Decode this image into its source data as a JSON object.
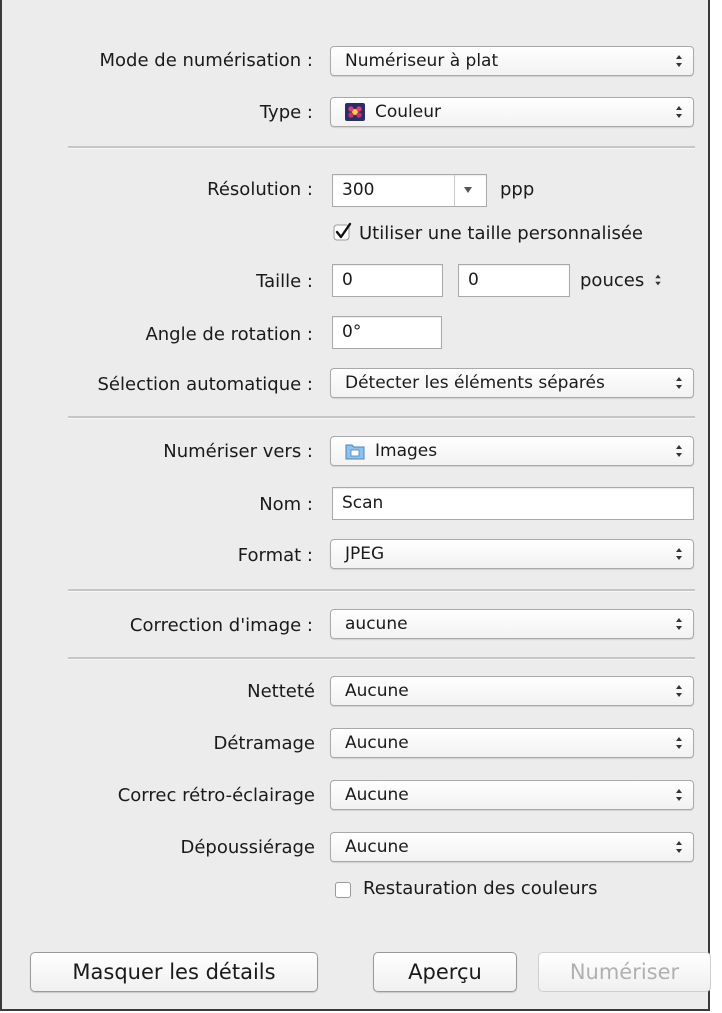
{
  "scan_mode": {
    "label": "Mode de numérisation :",
    "value": "Numériseur à plat"
  },
  "type": {
    "label": "Type :",
    "value": "Couleur",
    "icon": "color-flower-icon"
  },
  "resolution": {
    "label": "Résolution :",
    "value": "300",
    "unit": "ppp"
  },
  "custom_size": {
    "label": "Utiliser une taille personnalisée",
    "checked": true
  },
  "size": {
    "label": "Taille :",
    "width": "0",
    "height": "0",
    "unit": "pouces"
  },
  "rotation": {
    "label": "Angle de rotation :",
    "value": "0°"
  },
  "auto_selection": {
    "label": "Sélection automatique :",
    "value": "Détecter les éléments séparés"
  },
  "scan_to": {
    "label": "Numériser vers :",
    "value": "Images",
    "icon": "folder-icon"
  },
  "name": {
    "label": "Nom :",
    "value": "Scan"
  },
  "format": {
    "label": "Format :",
    "value": "JPEG"
  },
  "image_correction": {
    "label": "Correction d'image :",
    "value": "aucune"
  },
  "sharpness": {
    "label": "Netteté",
    "value": "Aucune"
  },
  "descreening": {
    "label": "Détramage",
    "value": "Aucune"
  },
  "backlight": {
    "label": "Correc rétro-éclairage",
    "value": "Aucune"
  },
  "dust_removal": {
    "label": "Dépoussiérage",
    "value": "Aucune"
  },
  "color_restoration": {
    "label": "Restauration des couleurs",
    "checked": false
  },
  "buttons": {
    "hide_details": "Masquer les détails",
    "preview": "Aperçu",
    "scan": "Numériser"
  },
  "colors": {
    "panel_bg": "#ececec",
    "disabled_text": "#b0b0b0"
  }
}
